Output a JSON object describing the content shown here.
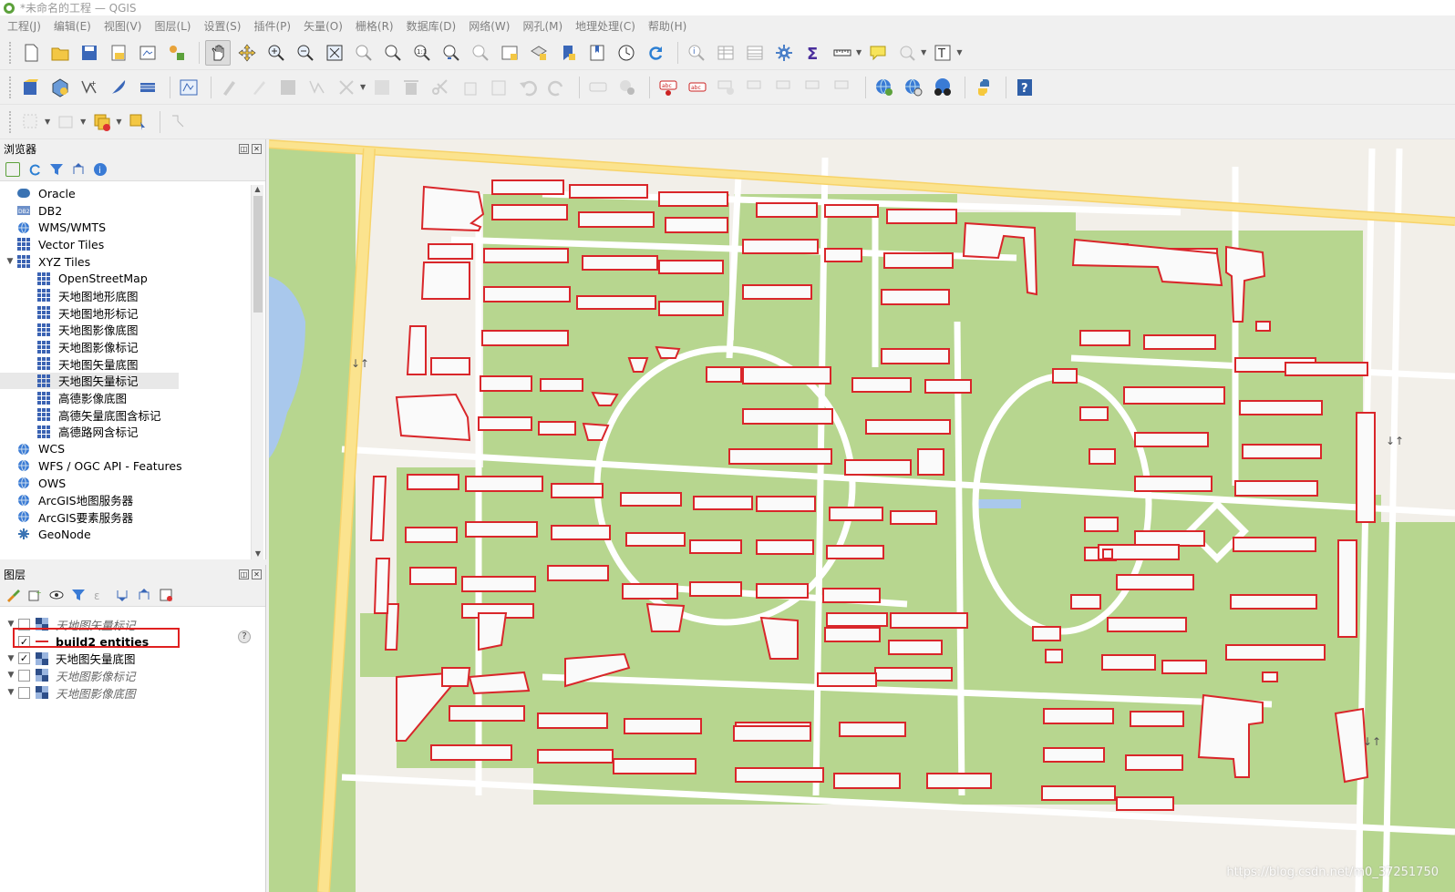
{
  "window": {
    "title": "*未命名的工程 — QGIS"
  },
  "menu": [
    "工程(J)",
    "编辑(E)",
    "视图(V)",
    "图层(L)",
    "设置(S)",
    "插件(P)",
    "矢量(O)",
    "栅格(R)",
    "数据库(D)",
    "网络(W)",
    "网孔(M)",
    "地理处理(C)",
    "帮助(H)"
  ],
  "browser": {
    "title": "浏览器",
    "items": [
      {
        "label": "Oracle",
        "icon": "database-icon",
        "level": 0
      },
      {
        "label": "DB2",
        "icon": "db2-icon",
        "level": 0
      },
      {
        "label": "WMS/WMTS",
        "icon": "globe-icon",
        "level": 0
      },
      {
        "label": "Vector Tiles",
        "icon": "grid-icon",
        "level": 0
      },
      {
        "label": "XYZ Tiles",
        "icon": "grid-icon",
        "level": 0,
        "expanded": true
      },
      {
        "label": "OpenStreetMap",
        "icon": "grid-icon",
        "level": 1
      },
      {
        "label": "天地图地形底图",
        "icon": "grid-icon",
        "level": 1
      },
      {
        "label": "天地图地形标记",
        "icon": "grid-icon",
        "level": 1
      },
      {
        "label": "天地图影像底图",
        "icon": "grid-icon",
        "level": 1
      },
      {
        "label": "天地图影像标记",
        "icon": "grid-icon",
        "level": 1
      },
      {
        "label": "天地图矢量底图",
        "icon": "grid-icon",
        "level": 1
      },
      {
        "label": "天地图矢量标记",
        "icon": "grid-icon",
        "level": 1,
        "selected": true
      },
      {
        "label": "高德影像底图",
        "icon": "grid-icon",
        "level": 1
      },
      {
        "label": "高德矢量底图含标记",
        "icon": "grid-icon",
        "level": 1
      },
      {
        "label": "高德路网含标记",
        "icon": "grid-icon",
        "level": 1
      },
      {
        "label": "WCS",
        "icon": "globe-icon",
        "level": 0
      },
      {
        "label": "WFS / OGC API - Features",
        "icon": "globe-icon",
        "level": 0
      },
      {
        "label": "OWS",
        "icon": "globe-icon",
        "level": 0
      },
      {
        "label": "ArcGIS地图服务器",
        "icon": "globe-icon",
        "level": 0
      },
      {
        "label": "ArcGIS要素服务器",
        "icon": "globe-icon",
        "level": 0
      },
      {
        "label": "GeoNode",
        "icon": "geonode-icon",
        "level": 0
      }
    ]
  },
  "layers": {
    "title": "图层",
    "items": [
      {
        "label": "天地图矢量标记",
        "checked": false,
        "italic": true,
        "type": "raster"
      },
      {
        "label": "build2 entities",
        "checked": true,
        "italic": false,
        "bold": true,
        "type": "vector",
        "highlighted": true,
        "help": "?"
      },
      {
        "label": "天地图矢量底图",
        "checked": true,
        "italic": false,
        "type": "raster"
      },
      {
        "label": "天地图影像标记",
        "checked": false,
        "italic": true,
        "type": "raster"
      },
      {
        "label": "天地图影像底图",
        "checked": false,
        "italic": true,
        "type": "raster"
      }
    ]
  },
  "map": {
    "watermark": "https://blog.csdn.net/m0_37251750",
    "colors": {
      "green": "#b7d68f",
      "road": "#ffffff",
      "major_road": "#fbe38e",
      "building_fill": "#fafafa",
      "building_stroke": "#d9262a",
      "water": "#a9c8ec",
      "base": "#f2efe9"
    }
  },
  "colors": {
    "accent": "#3b63b3",
    "highlight_box": "#e02020"
  }
}
